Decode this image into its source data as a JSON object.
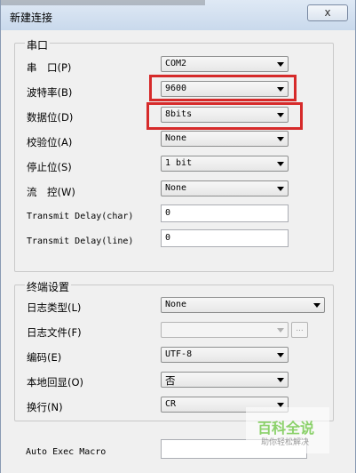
{
  "window": {
    "title": "新建连接",
    "close_label": "x"
  },
  "serial": {
    "group_title": "串口",
    "port_label": "串　口(P)",
    "port_value": "COM2",
    "baud_label": "波特率(B)",
    "baud_value": "9600",
    "databits_label": "数据位(D)",
    "databits_value": "8bits",
    "parity_label": "校验位(A)",
    "parity_value": "None",
    "stopbits_label": "停止位(S)",
    "stopbits_value": "1 bit",
    "flow_label": "流　控(W)",
    "flow_value": "None",
    "tx_delay_char_label": "Transmit Delay(char)",
    "tx_delay_char_value": "0",
    "tx_delay_line_label": "Transmit Delay(line)",
    "tx_delay_line_value": "0"
  },
  "terminal": {
    "group_title": "终端设置",
    "logtype_label": "日志类型(L)",
    "logtype_value": "None",
    "logfile_label": "日志文件(F)",
    "logfile_value": "",
    "browse_label": "...",
    "encoding_label": "编码(E)",
    "encoding_value": "UTF-8",
    "echo_label": "本地回显(O)",
    "echo_value": "否",
    "newline_label": "换行(N)",
    "newline_value": "CR"
  },
  "macro": {
    "label": "Auto Exec Macro",
    "value": ""
  },
  "watermark": {
    "title": "百科全说",
    "subtitle": "助你轻松解决"
  },
  "colors": {
    "highlight": "#d62a2a",
    "watermark": "#8bd16a"
  }
}
